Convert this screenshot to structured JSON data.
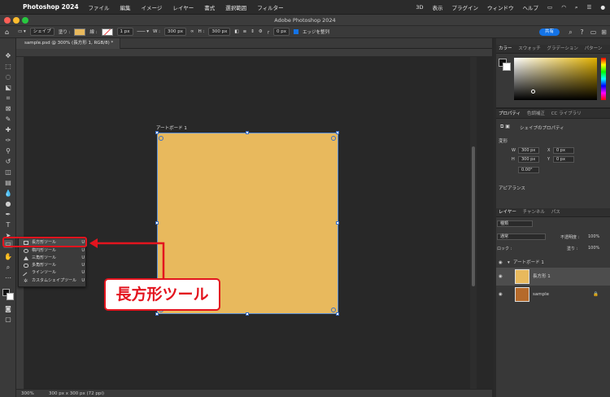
{
  "menubar": {
    "app_name": "Photoshop 2024",
    "items": [
      "ファイル",
      "編集",
      "イメージ",
      "レイヤー",
      "書式",
      "選択範囲",
      "フィルター",
      "3D",
      "表示",
      "プラグイン",
      "ウィンドウ",
      "ヘルプ"
    ]
  },
  "window": {
    "title": "Adobe Photoshop 2024",
    "doc_tab": "sample.psd @ 300% (長方形 1, RGB/8) *"
  },
  "options": {
    "mode": "シェイプ",
    "fill_label": "塗り :",
    "stroke_label": "線 :",
    "stroke_width": "1 px",
    "w_label": "W :",
    "w_value": "300 px",
    "h_label": "H :",
    "h_value": "300 px",
    "radius": "0 px",
    "align_edges": "エッジを整列",
    "share": "共有",
    "fill_color": "#e8b95d"
  },
  "canvas": {
    "artboard_label": "アートボード 1",
    "artboard_color": "#e8b95d"
  },
  "flyout": {
    "items": [
      {
        "label": "長方形ツール",
        "key": "U"
      },
      {
        "label": "楕円形ツール",
        "key": "U"
      },
      {
        "label": "三角形ツール",
        "key": "U"
      },
      {
        "label": "多角形ツール",
        "key": "U"
      },
      {
        "label": "ラインツール",
        "key": "U"
      },
      {
        "label": "カスタムシェイプツール",
        "key": "U"
      }
    ]
  },
  "callout": {
    "text": "長方形ツール",
    "color": "#e3141e"
  },
  "status": {
    "zoom": "300%",
    "info": "300 px x 300 px (72 ppi)"
  },
  "panels": {
    "color_tabs": [
      "カラー",
      "スウォッチ",
      "グラデーション",
      "パターン"
    ],
    "props_tabs": [
      "プロパティ",
      "色調補正",
      "CC ライブラリ"
    ],
    "shape_props": "シェイプのプロパティ",
    "transform": "変形",
    "w": "300 px",
    "h": "300 px",
    "x": "0 px",
    "y": "0 px",
    "angle": "0.00°",
    "appearance": "アピアランス",
    "layer_tabs": [
      "レイヤー",
      "チャンネル",
      "パス"
    ],
    "kind": "種類",
    "blend": "通常",
    "opacity_label": "不透明度 :",
    "opacity": "100%",
    "lock_label": "ロック :",
    "fill_label": "塗り :",
    "fill": "100%",
    "layers": [
      "アートボード 1",
      "長方形 1",
      "sample"
    ]
  }
}
